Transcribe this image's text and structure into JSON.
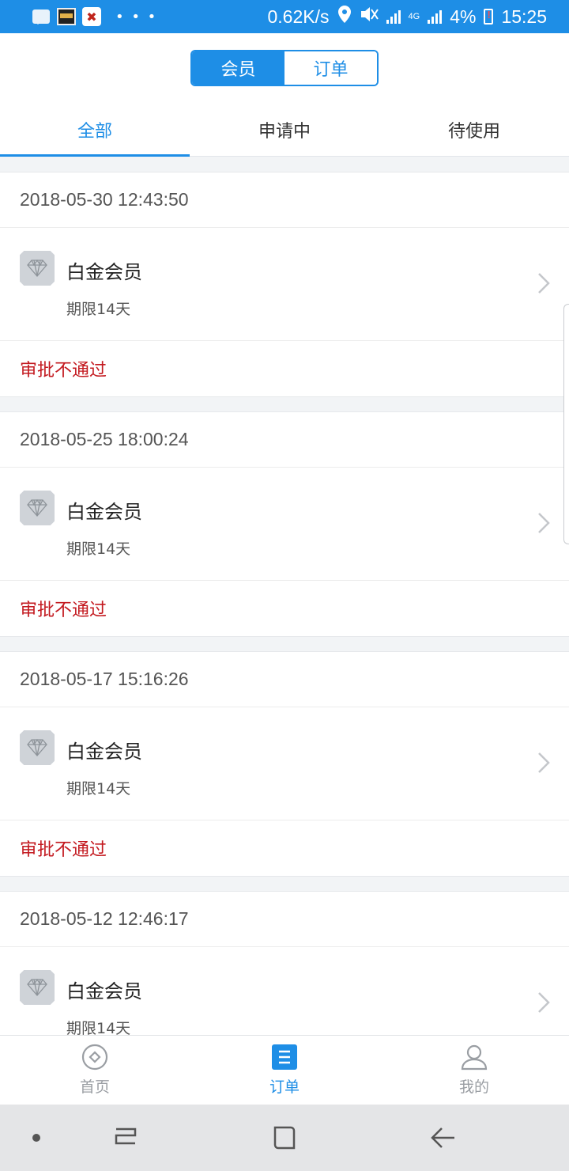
{
  "status_bar": {
    "network_speed": "0.62K/s",
    "network_label": "4G",
    "battery_percent": "4%",
    "time": "15:25",
    "app2_glyph": "✖",
    "dots": "• • •"
  },
  "header": {
    "segments": [
      {
        "label": "会员",
        "active": true
      },
      {
        "label": "订单",
        "active": false
      }
    ]
  },
  "tabs": [
    {
      "label": "全部",
      "active": true
    },
    {
      "label": "申请中",
      "active": false
    },
    {
      "label": "待使用",
      "active": false
    }
  ],
  "orders": [
    {
      "time": "2018-05-30 12:43:50",
      "title": "白金会员",
      "duration": "期限14天",
      "status": "审批不通过"
    },
    {
      "time": "2018-05-25 18:00:24",
      "title": "白金会员",
      "duration": "期限14天",
      "status": "审批不通过"
    },
    {
      "time": "2018-05-17 15:16:26",
      "title": "白金会员",
      "duration": "期限14天",
      "status": "审批不通过"
    },
    {
      "time": "2018-05-12 12:46:17",
      "title": "白金会员",
      "duration": "期限14天",
      "status": ""
    }
  ],
  "bottom_nav": [
    {
      "label": "首页",
      "icon": "home-icon",
      "active": false
    },
    {
      "label": "订单",
      "icon": "orders-icon",
      "active": true
    },
    {
      "label": "我的",
      "icon": "profile-icon",
      "active": false
    }
  ],
  "colors": {
    "primary": "#1e8ee6",
    "status_rejected": "#c3191f",
    "inactive": "#9a9ea3"
  }
}
